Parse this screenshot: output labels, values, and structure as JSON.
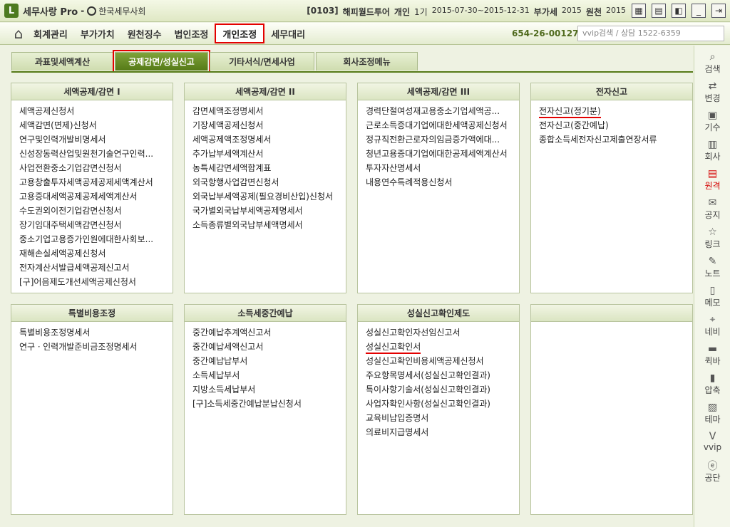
{
  "title_bar": {
    "logo": "L",
    "app_name": "세무사랑 Pro",
    "separator": "-",
    "org_name": "한국세무사회",
    "company_code": "[0103]",
    "company_name": "해피월드투어",
    "company_type": "개인",
    "period_label": "1기",
    "period": "2015-07-30~2015-12-31",
    "tax_type_label": "부가세",
    "tax_year": "2015",
    "withholding_label": "원천",
    "withholding_year": "2015"
  },
  "menu": {
    "items": [
      "회계관리",
      "부가가치",
      "원천징수",
      "법인조정",
      "개인조정",
      "세무대리"
    ],
    "active": "개인조정",
    "business_no": "654-26-00127",
    "search_text": "vvip검색 / 상담 1522-6359"
  },
  "subtabs": {
    "items": [
      "과표및세액계산",
      "공제감면/성실신고",
      "기타서식/면세사업",
      "회사조정메뉴"
    ],
    "active": "공제감면/성실신고"
  },
  "panels": [
    {
      "title": "세액공제/감면 I",
      "items": [
        "세액공제신청서",
        "세액감면(면제)신청서",
        "연구및인력개발비명세서",
        "신성장동력산업및원천기술연구인력...",
        "사업전환중소기업감면신청서",
        "고용창출투자세액공제공제세액계산서",
        "고용증대세액공제공제세액계산서",
        "수도권외이전기업감면신청서",
        "장기임대주택세액감면신청서",
        "중소기업고용증가인원에대한사회보...",
        "재해손실세액공제신청서",
        "전자계산서발급세액공제신고서",
        "[구]어음제도개선세액공제신청서"
      ]
    },
    {
      "title": "세액공제/감면 II",
      "items": [
        "감면세액조정명세서",
        "기장세액공제신청서",
        "세액공제액조정명세서",
        "추가납부세액계산서",
        "농특세감면세액합계표",
        "외국항행사업감면신청서",
        "외국납부세액공제(필요경비산입)신청서",
        "국가별외국납부세액공제명세서",
        "소득종류별외국납부세액명세서"
      ]
    },
    {
      "title": "세액공제/감면 III",
      "items": [
        "경력단절여성재고용중소기업세액공...",
        "근로소득증대기업에대한세액공제신청서",
        "정규직전환근로자의임금증가액에대...",
        "청년고용증대기업에대한공제세액계산서",
        "투자자산명세서",
        "내용연수특례적용신청서"
      ]
    },
    {
      "title": "전자신고",
      "items": [
        "전자신고(정기분)",
        "전자신고(중간예납)",
        "종합소득세전자신고제출연장서류"
      ]
    },
    {
      "title": "특별비용조정",
      "items": [
        "특별비용조정명세서",
        "연구ㆍ인력개발준비금조정명세서"
      ]
    },
    {
      "title": "소득세중간예납",
      "items": [
        "중간예납추계액신고서",
        "중간예납세액신고서",
        "중간예납납부서",
        "소득세납부서",
        "지방소득세납부서",
        "[구]소득세중간예납분납신청서"
      ]
    },
    {
      "title": "성실신고확인제도",
      "items": [
        "성실신고확인자선임신고서",
        "성실신고확인서",
        "성실신고확인비용세액공제신청서",
        "주요항목명세서(성실신고확인결과)",
        "특이사항기술서(성실신고확인결과)",
        "사업자확인사항(성실신고확인결과)",
        "교육비납입증명서",
        "의료비지급명세서"
      ]
    },
    {
      "title": "",
      "items": []
    }
  ],
  "sidebar": {
    "items": [
      {
        "label": "검색",
        "icon": "search-icon"
      },
      {
        "label": "변경",
        "icon": "change-icon"
      },
      {
        "label": "기수",
        "icon": "calendar-icon"
      },
      {
        "label": "회사",
        "icon": "building-icon"
      },
      {
        "label": "원격",
        "icon": "remote-icon"
      },
      {
        "label": "공지",
        "icon": "notice-icon"
      },
      {
        "label": "링크",
        "icon": "star-icon"
      },
      {
        "label": "노트",
        "icon": "note-icon"
      },
      {
        "label": "메모",
        "icon": "memo-icon"
      },
      {
        "label": "네비",
        "icon": "navi-icon"
      },
      {
        "label": "퀵바",
        "icon": "quickbar-icon"
      },
      {
        "label": "압축",
        "icon": "zip-icon"
      },
      {
        "label": "테마",
        "icon": "theme-icon"
      },
      {
        "label": "vvip",
        "icon": "vvip-icon"
      },
      {
        "label": "공단",
        "icon": "agency-icon"
      }
    ]
  }
}
